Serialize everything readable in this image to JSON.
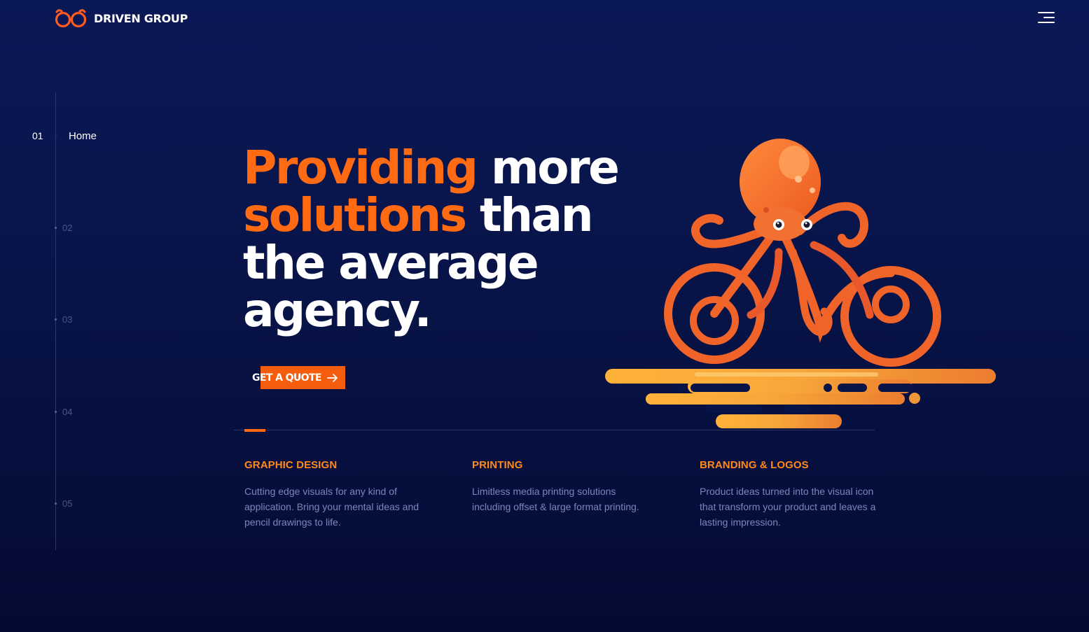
{
  "header": {
    "brand_name": "DRIVEN GROUP",
    "logo_icon": "infinity-glasses-logo",
    "menu_icon": "hamburger-menu-icon"
  },
  "side_nav": {
    "items": [
      {
        "number": "01",
        "label": "Home",
        "active": true
      },
      {
        "number": "02",
        "label": "",
        "active": false
      },
      {
        "number": "03",
        "label": "",
        "active": false
      },
      {
        "number": "04",
        "label": "",
        "active": false
      },
      {
        "number": "05",
        "label": "",
        "active": false
      }
    ]
  },
  "hero": {
    "line1_accent": "Providing",
    "line1_rest": " more",
    "line2_accent": "solutions",
    "line2_rest": " than",
    "line3": "the average",
    "line4": "agency.",
    "cta_label": "GET A QUOTE",
    "cta_icon": "arrow-right-icon",
    "illustration": "octopus-riding-bicycle"
  },
  "services": [
    {
      "title": "GRAPHIC DESIGN",
      "description": "Cutting edge visuals for any kind of application. Bring your mental ideas and pencil drawings to life."
    },
    {
      "title": "PRINTING",
      "description": "Limitless media printing solutions including offset & large format printing."
    },
    {
      "title": "BRANDING & LOGOS",
      "description": "Product ideas turned into the visual icon that transform your product and leaves a lasting impression."
    }
  ],
  "colors": {
    "background_top": "#0b1856",
    "background_bottom": "#040a33",
    "accent": "#ff6a12",
    "service_title": "#ff8a1c",
    "body_text": "#7b87ba"
  }
}
